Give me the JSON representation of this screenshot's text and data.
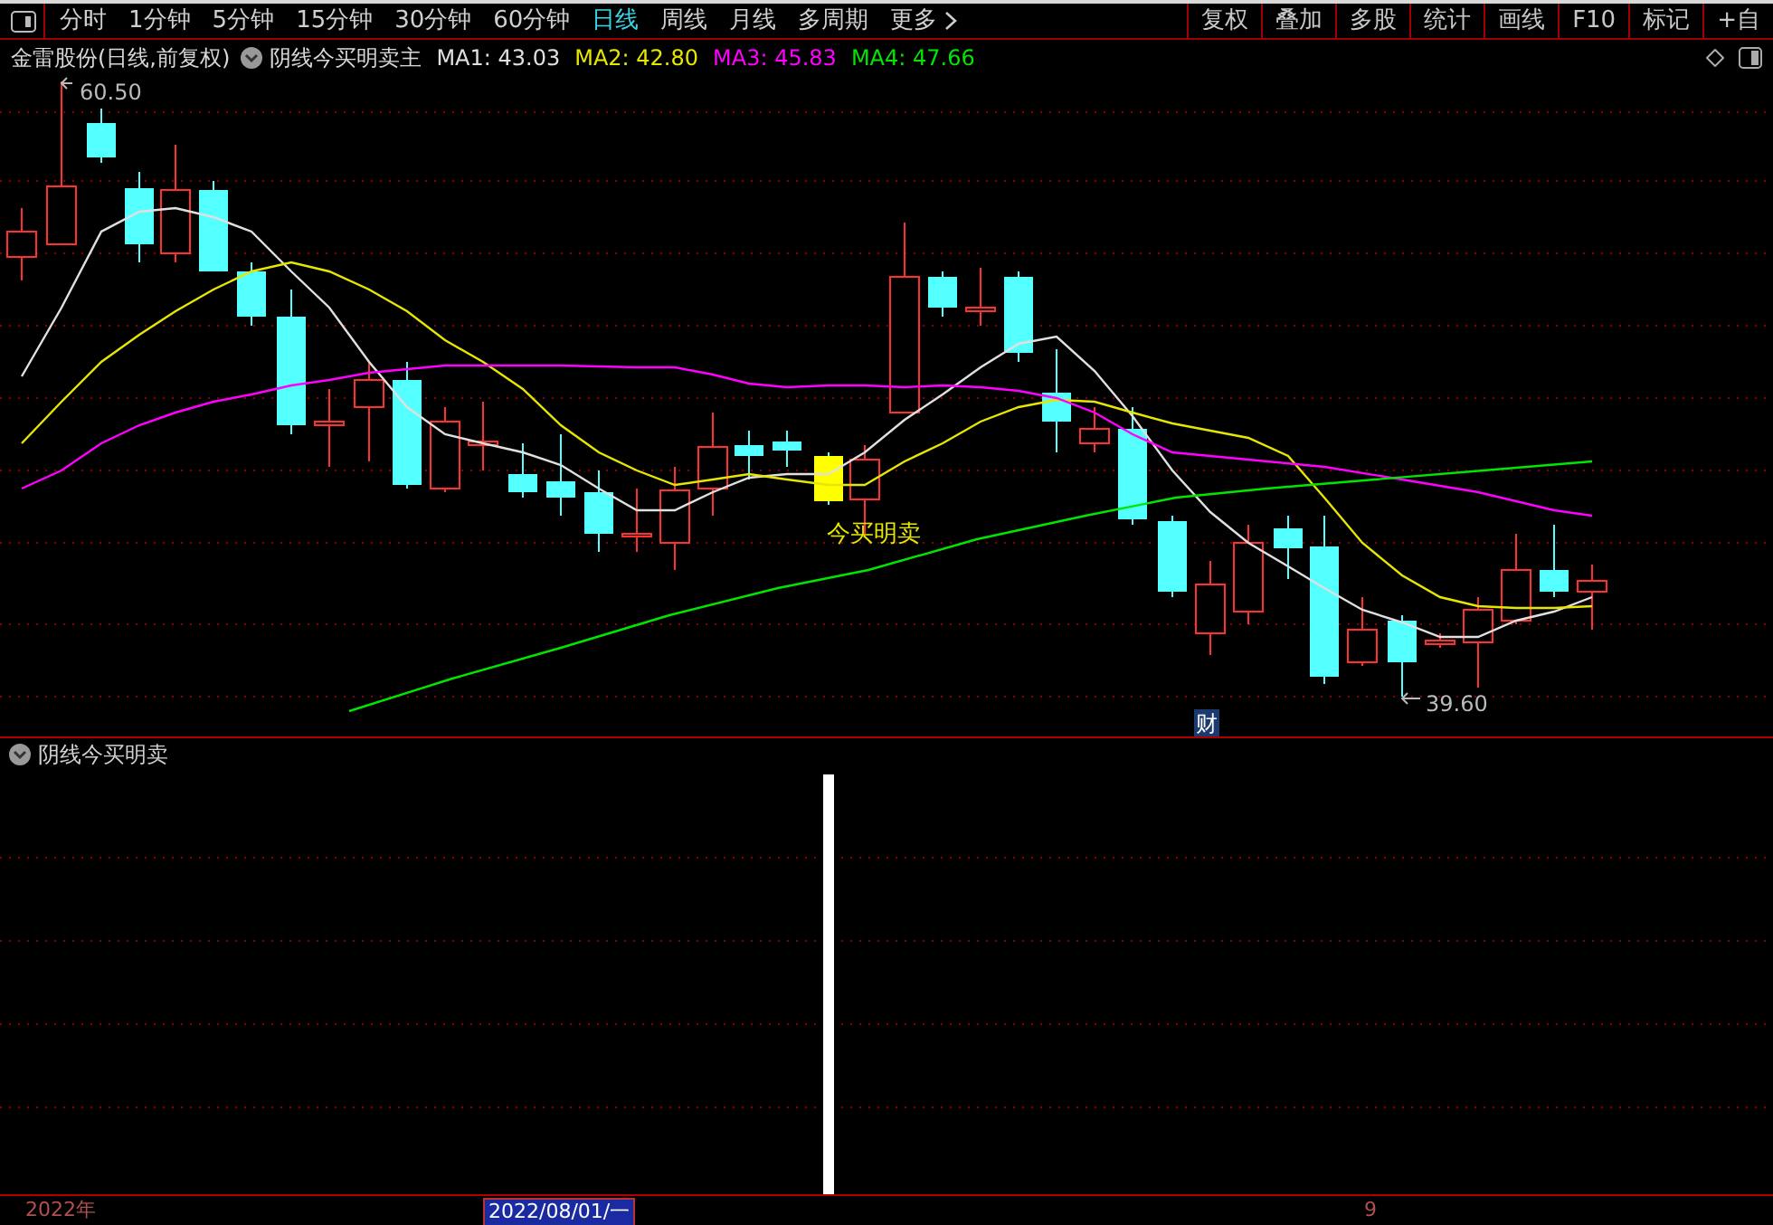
{
  "toolbar": {
    "periods": [
      {
        "label": "分时",
        "selected": false
      },
      {
        "label": "1分钟",
        "selected": false
      },
      {
        "label": "5分钟",
        "selected": false
      },
      {
        "label": "15分钟",
        "selected": false
      },
      {
        "label": "30分钟",
        "selected": false
      },
      {
        "label": "60分钟",
        "selected": false
      },
      {
        "label": "日线",
        "selected": true
      },
      {
        "label": "周线",
        "selected": false
      },
      {
        "label": "月线",
        "selected": false
      },
      {
        "label": "多周期",
        "selected": false
      },
      {
        "label": "更多",
        "selected": false
      }
    ],
    "tools": [
      "复权",
      "叠加",
      "多股",
      "统计",
      "画线",
      "F10",
      "标记",
      "+自"
    ]
  },
  "main_chart": {
    "stock_title": "金雷股份(日线,前复权)",
    "indicator_name": "阴线今买明卖主",
    "moving_averages": [
      {
        "label": "MA1: 43.03",
        "color": "#e0e0e0"
      },
      {
        "label": "MA2: 42.80",
        "color": "#e6e600"
      },
      {
        "label": "MA3: 45.83",
        "color": "#ff00ff"
      },
      {
        "label": "MA4: 47.66",
        "color": "#00e600"
      }
    ],
    "high_label": "60.50",
    "low_label": "39.60",
    "signal_label": "今买明卖",
    "event_marker": "财"
  },
  "indicator_panel": {
    "title": "阴线今买明卖"
  },
  "time_axis": {
    "labels": [
      {
        "text": "2022年",
        "selected": false
      },
      {
        "text": "2022/08/01/一",
        "selected": true
      },
      {
        "text": "9",
        "selected": false
      }
    ]
  }
}
